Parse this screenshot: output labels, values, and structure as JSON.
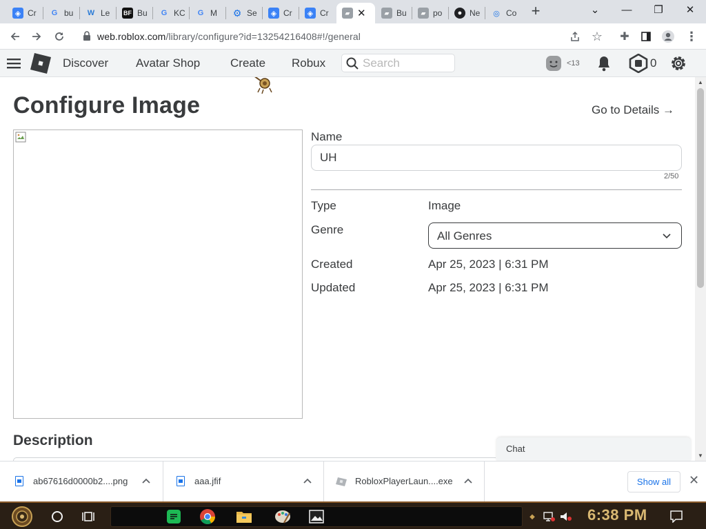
{
  "browser": {
    "tabs": [
      {
        "title": "Cr",
        "icon": "roblox-studio-icon",
        "color": "#3b82f6"
      },
      {
        "title": "bu",
        "icon": "google-icon",
        "color": "#4285f4"
      },
      {
        "title": "Le",
        "icon": "w-logo-icon",
        "color": "#2b7bd6"
      },
      {
        "title": "Bu",
        "icon": "bf-logo-icon",
        "color": "#111111"
      },
      {
        "title": "KC",
        "icon": "google-icon",
        "color": "#4285f4"
      },
      {
        "title": "M",
        "icon": "google-icon",
        "color": "#4285f4"
      },
      {
        "title": "Se",
        "icon": "gear-icon",
        "color": "#1a73e8"
      },
      {
        "title": "Cr",
        "icon": "roblox-studio-icon",
        "color": "#3b82f6"
      },
      {
        "title": "Cr",
        "icon": "roblox-studio-icon",
        "color": "#3b82f6"
      },
      {
        "title": "",
        "icon": "roblox-icon",
        "color": "#9aa0a6",
        "active": true
      },
      {
        "title": "Bu",
        "icon": "roblox-icon",
        "color": "#9aa0a6"
      },
      {
        "title": "po",
        "icon": "roblox-icon",
        "color": "#9aa0a6"
      },
      {
        "title": "Ne",
        "icon": "github-icon",
        "color": "#202124"
      },
      {
        "title": "Co",
        "icon": "search-globe-icon",
        "color": "#1a73e8"
      }
    ],
    "url_host": "web.roblox.com",
    "url_path": "/library/configure?id=13254216408#!/general"
  },
  "nav": {
    "items": [
      "Discover",
      "Avatar Shop",
      "Create",
      "Robux"
    ],
    "search_placeholder": "Search",
    "age_label": "<13",
    "robux_count": "0"
  },
  "page": {
    "title": "Configure Image",
    "go_to_details": "Go to Details",
    "name_label": "Name",
    "name_value": "UH",
    "name_counter": "2/50",
    "type_label": "Type",
    "type_value": "Image",
    "genre_label": "Genre",
    "genre_value": "All Genres",
    "created_label": "Created",
    "created_value": "Apr 25, 2023 | 6:31 PM",
    "updated_label": "Updated",
    "updated_value": "Apr 25, 2023 | 6:31 PM",
    "description_title": "Description",
    "chat_label": "Chat"
  },
  "downloads": {
    "items": [
      {
        "name": "ab67616d0000b2....png"
      },
      {
        "name": "aaa.jfif"
      },
      {
        "name": "RobloxPlayerLaun....exe"
      }
    ],
    "show_all": "Show all"
  },
  "taskbar": {
    "clock": "6:38 PM"
  }
}
